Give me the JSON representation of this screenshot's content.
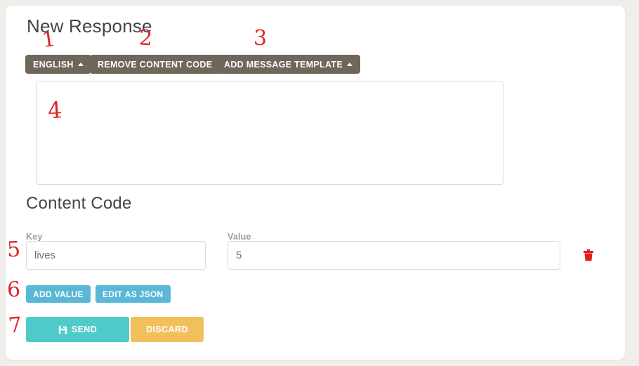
{
  "page": {
    "title": "New Response",
    "section_title": "Content Code",
    "background_color": "#efeeea",
    "card_color": "#ffffff"
  },
  "toolbar": {
    "language_label": "ENGLISH",
    "language_caret": "caret-up-icon",
    "remove_content_code_label": "REMOVE CONTENT CODE",
    "add_message_template_label": "ADD MESSAGE TEMPLATE",
    "add_message_template_caret": "caret-up-icon",
    "button_color": "#6f665c"
  },
  "message": {
    "value": "",
    "placeholder": ""
  },
  "content_code": {
    "key_label": "Key",
    "value_label": "Value",
    "rows": [
      {
        "key": "lives",
        "value": "5"
      }
    ],
    "delete_icon": "trash-icon",
    "delete_color": "#e02020",
    "add_value_label": "ADD VALUE",
    "edit_as_json_label": "EDIT AS JSON",
    "action_color": "#5bb7d6"
  },
  "footer": {
    "send_label": "SEND",
    "send_icon": "save-floppy-icon",
    "send_color": "#4fcbcb",
    "discard_label": "DISCARD",
    "discard_color": "#f2c05a"
  },
  "annotations": {
    "n1": "1",
    "n2": "2",
    "n3": "3",
    "n4": "4",
    "n5": "5",
    "n6": "6",
    "n7": "7",
    "color": "#e02427"
  }
}
